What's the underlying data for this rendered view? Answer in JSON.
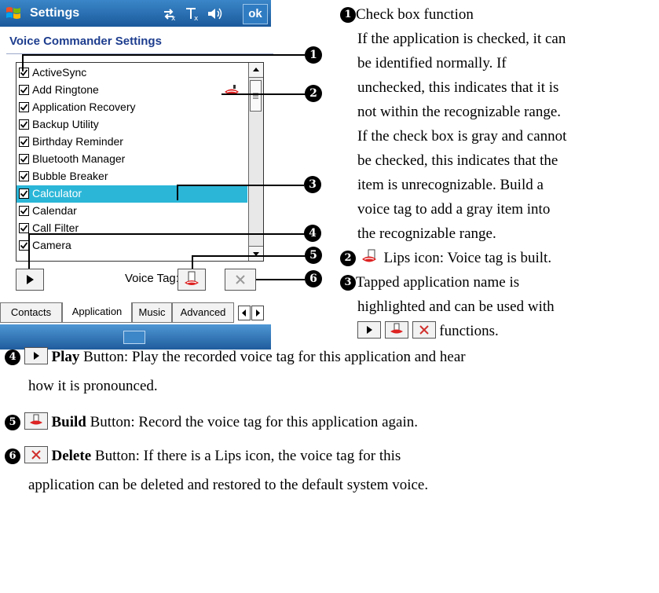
{
  "window": {
    "title": "Settings",
    "ok_label": "ok"
  },
  "panel": {
    "subtitle": "Voice Commander Settings",
    "apps": [
      {
        "label": "ActiveSync",
        "checked": true,
        "selected": false,
        "voice_tag": false
      },
      {
        "label": "Add Ringtone",
        "checked": true,
        "selected": false,
        "voice_tag": true
      },
      {
        "label": "Application Recovery",
        "checked": true,
        "selected": false,
        "voice_tag": false
      },
      {
        "label": "Backup Utility",
        "checked": true,
        "selected": false,
        "voice_tag": false
      },
      {
        "label": "Birthday Reminder",
        "checked": true,
        "selected": false,
        "voice_tag": false
      },
      {
        "label": "Bluetooth Manager",
        "checked": true,
        "selected": false,
        "voice_tag": false
      },
      {
        "label": "Bubble Breaker",
        "checked": true,
        "selected": false,
        "voice_tag": false
      },
      {
        "label": "Calculator",
        "checked": true,
        "selected": true,
        "voice_tag": false
      },
      {
        "label": "Calendar",
        "checked": true,
        "selected": false,
        "voice_tag": false
      },
      {
        "label": "Call Filter",
        "checked": true,
        "selected": false,
        "voice_tag": false
      },
      {
        "label": "Camera",
        "checked": true,
        "selected": false,
        "voice_tag": false
      }
    ],
    "voice_tag_label": "Voice Tag:"
  },
  "tabs": [
    {
      "label": "Contacts",
      "active": false
    },
    {
      "label": "Application",
      "active": true
    },
    {
      "label": "Music",
      "active": false
    },
    {
      "label": "Advanced",
      "active": false
    }
  ],
  "markers": [
    "1",
    "2",
    "3",
    "4",
    "5",
    "6"
  ],
  "notes": {
    "n1": {
      "marker": "1",
      "lines": [
        "Check box function",
        "If the application is checked, it can",
        "be identified normally. If",
        "unchecked, this indicates that it is",
        "not within the recognizable range.",
        "If the check box is gray and cannot",
        "be checked, this indicates that the",
        "item is unrecognizable. Build a",
        "voice tag to add a gray item into",
        "the recognizable range."
      ]
    },
    "n2": {
      "marker": "2",
      "text": "Lips icon: Voice tag is built."
    },
    "n3": {
      "marker": "3",
      "line1": "Tapped application name is",
      "line2": "highlighted and can be used with",
      "tail": "functions."
    },
    "n4": {
      "marker": "4",
      "bold": "Play",
      "text": "Button: Play the recorded voice tag for this application and hear",
      "cont": "how it is pronounced."
    },
    "n5": {
      "marker": "5",
      "bold": "Build",
      "text": "Button: Record the voice tag for this application again."
    },
    "n6": {
      "marker": "6",
      "bold": "Delete",
      "text": "Button: If there is a Lips icon, the voice tag for this",
      "cont": "application can be deleted and restored to the default system voice."
    }
  },
  "colors": {
    "title_bar": "#1b5a9c",
    "selection": "#2bb6d8",
    "subtitle": "#1d3d8e",
    "delete_x": "#d0312d"
  }
}
